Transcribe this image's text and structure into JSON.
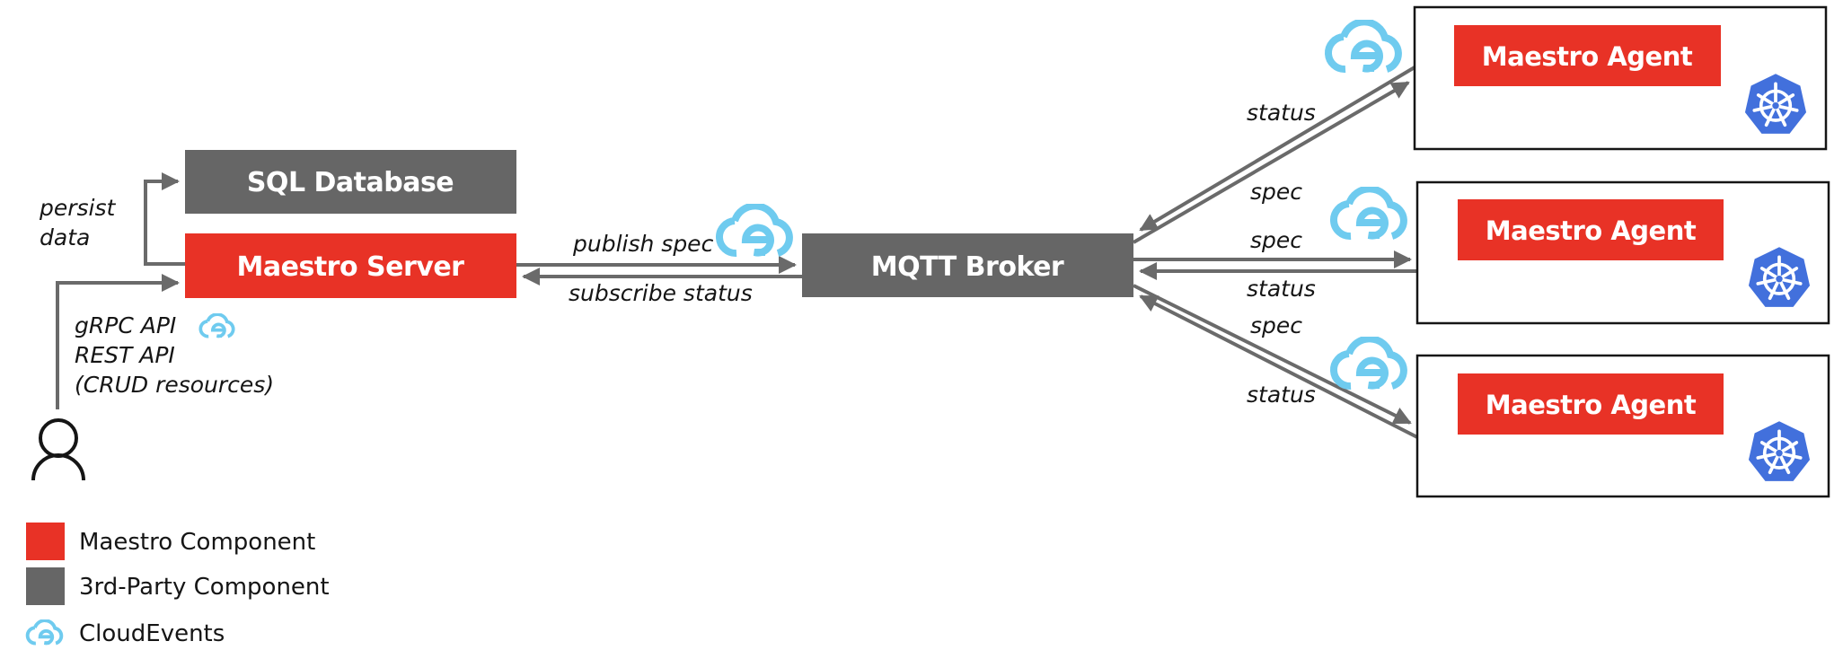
{
  "colors": {
    "maestro": "#E83226",
    "third_party": "#666666",
    "cloudevents": "#6FCBEF",
    "kubernetes": "#4270DC",
    "arrow": "#6A6A6A"
  },
  "components": {
    "sql_database": {
      "label": "SQL Database",
      "kind": "third_party"
    },
    "maestro_server": {
      "label": "Maestro Server",
      "kind": "maestro"
    },
    "mqtt_broker": {
      "label": "MQTT Broker",
      "kind": "third_party"
    },
    "agents": [
      {
        "label": "Maestro Agent",
        "kind": "maestro",
        "platform_icon": "kubernetes-icon"
      },
      {
        "label": "Maestro Agent",
        "kind": "maestro",
        "platform_icon": "kubernetes-icon"
      },
      {
        "label": "Maestro Agent",
        "kind": "maestro",
        "platform_icon": "kubernetes-icon"
      }
    ]
  },
  "edges": {
    "persist": {
      "line1": "persist",
      "line2": "data"
    },
    "user_api": {
      "line1": "gRPC API",
      "line2": "REST API",
      "line3": "(CRUD resources)"
    },
    "server_to_broker": "publish spec",
    "broker_to_server": "subscribe status",
    "agent1": {
      "status": "status",
      "spec": "spec"
    },
    "agent2": {
      "spec": "spec",
      "status": "status"
    },
    "agent3": {
      "spec": "spec",
      "status": "status"
    }
  },
  "legend": [
    {
      "label": "Maestro Component",
      "swatch": "maestro"
    },
    {
      "label": "3rd-Party Component",
      "swatch": "third_party"
    },
    {
      "label": "CloudEvents",
      "swatch": "cloudevents-icon"
    }
  ]
}
